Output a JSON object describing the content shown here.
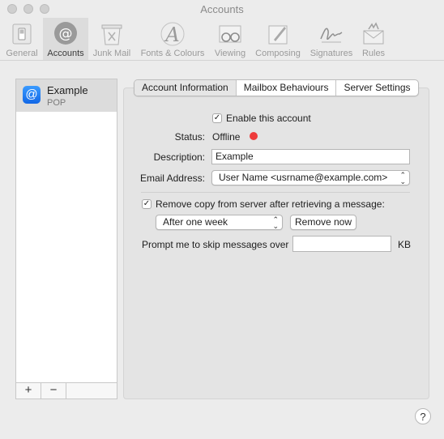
{
  "window": {
    "title": "Accounts"
  },
  "toolbar": {
    "items": [
      {
        "label": "General",
        "icon": "general-switch-icon"
      },
      {
        "label": "Accounts",
        "icon": "at-sign-icon",
        "active": true
      },
      {
        "label": "Junk Mail",
        "icon": "junk-bin-icon"
      },
      {
        "label": "Fonts & Colours",
        "icon": "font-a-icon"
      },
      {
        "label": "Viewing",
        "icon": "glasses-icon"
      },
      {
        "label": "Composing",
        "icon": "pen-paper-icon"
      },
      {
        "label": "Signatures",
        "icon": "signature-icon"
      },
      {
        "label": "Rules",
        "icon": "rules-envelope-icon"
      }
    ]
  },
  "sidebar": {
    "account": {
      "name": "Example",
      "type": "POP",
      "icon": "at-sign-icon"
    },
    "add_label": "+",
    "remove_label": "−"
  },
  "tabs": [
    {
      "label": "Account Information",
      "selected": true
    },
    {
      "label": "Mailbox Behaviours"
    },
    {
      "label": "Server Settings"
    }
  ],
  "form": {
    "enable_label": "Enable this account",
    "enable_checked": true,
    "status_label": "Status:",
    "status_value": "Offline",
    "status_color": "#ee3b3b",
    "description_label": "Description:",
    "description_value": "Example",
    "email_label": "Email Address:",
    "email_value": "User Name <usrname@example.com>",
    "remove_copy_label": "Remove copy from server after retrieving a message:",
    "remove_copy_checked": true,
    "remove_after_value": "After one week",
    "remove_now_label": "Remove now",
    "skip_label": "Prompt me to skip messages over",
    "skip_value": "",
    "skip_unit": "KB"
  },
  "help_label": "?"
}
